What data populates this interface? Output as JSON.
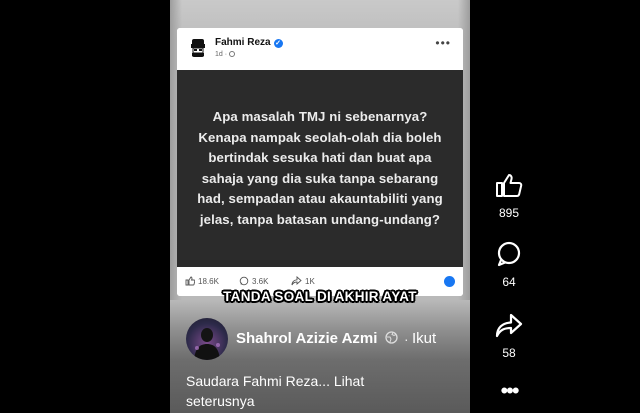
{
  "post": {
    "poster_name": "Fahmi Reza",
    "time": "1d ·",
    "text": "Apa masalah TMJ ni sebenarnya? Kenapa nampak seolah-olah dia boleh bertindak sesuka hati dan buat apa sahaja yang dia suka tanpa sebarang had, sempadan atau akauntabiliti yang jelas, tanpa batasan undang-undang?",
    "reactions": {
      "likes": "18.6K",
      "comments": "3.6K",
      "shares": "1K"
    }
  },
  "caption": "TANDA SOAL DI AKHIR AYAT",
  "creator": {
    "name": "Shahrol Azizie Azmi",
    "separator": "·",
    "follow_label": "Ikut",
    "description": "Saudara Fahmi Reza... Lihat seterusnya"
  },
  "actions": {
    "likes": "895",
    "comments": "64",
    "shares": "58"
  },
  "colors": {
    "facebook_blue": "#1877f2",
    "post_background": "#2b2b2b"
  }
}
